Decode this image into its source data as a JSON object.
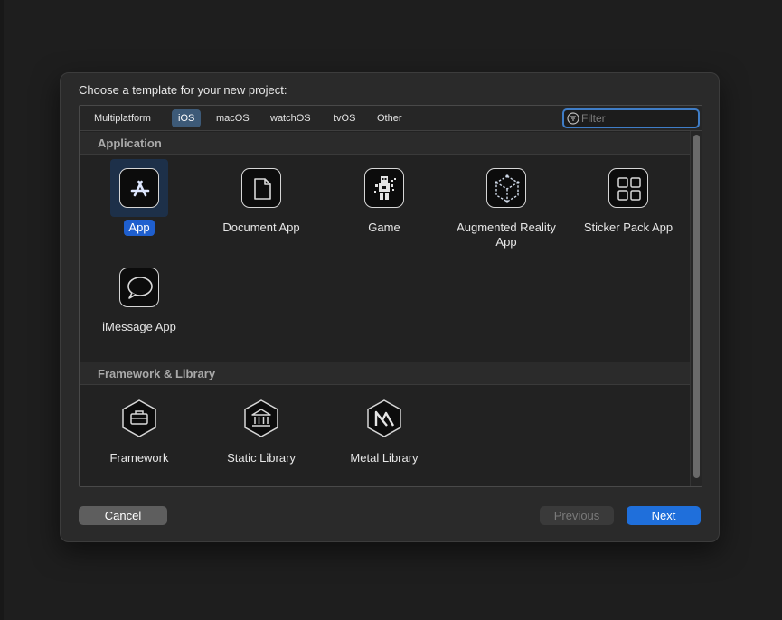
{
  "dialog": {
    "title": "Choose a template for your new project:"
  },
  "tabs": [
    {
      "label": "Multiplatform",
      "selected": false
    },
    {
      "label": "iOS",
      "selected": true
    },
    {
      "label": "macOS",
      "selected": false
    },
    {
      "label": "watchOS",
      "selected": false
    },
    {
      "label": "tvOS",
      "selected": false
    },
    {
      "label": "Other",
      "selected": false
    }
  ],
  "filter": {
    "placeholder": "Filter",
    "value": ""
  },
  "sections": {
    "application": {
      "title": "Application",
      "items": [
        {
          "label": "App",
          "icon": "app-store-icon",
          "selected": true
        },
        {
          "label": "Document App",
          "icon": "document-icon",
          "selected": false
        },
        {
          "label": "Game",
          "icon": "game-robot-icon",
          "selected": false
        },
        {
          "label": "Augmented Reality App",
          "icon": "ar-cube-icon",
          "selected": false
        },
        {
          "label": "Sticker Pack App",
          "icon": "grid-icon",
          "selected": false
        },
        {
          "label": "iMessage App",
          "icon": "message-bubble-icon",
          "selected": false
        }
      ]
    },
    "framework": {
      "title": "Framework & Library",
      "items": [
        {
          "label": "Framework",
          "icon": "toolbox-icon",
          "selected": false
        },
        {
          "label": "Static Library",
          "icon": "library-building-icon",
          "selected": false
        },
        {
          "label": "Metal Library",
          "icon": "metal-icon",
          "selected": false
        }
      ]
    }
  },
  "buttons": {
    "cancel": "Cancel",
    "previous": "Previous",
    "next": "Next"
  },
  "colors": {
    "accent": "#1f6fdb",
    "selection_label": "#1f5fce",
    "tab_selected": "#3d5a78",
    "background": "#2a2a2a"
  }
}
